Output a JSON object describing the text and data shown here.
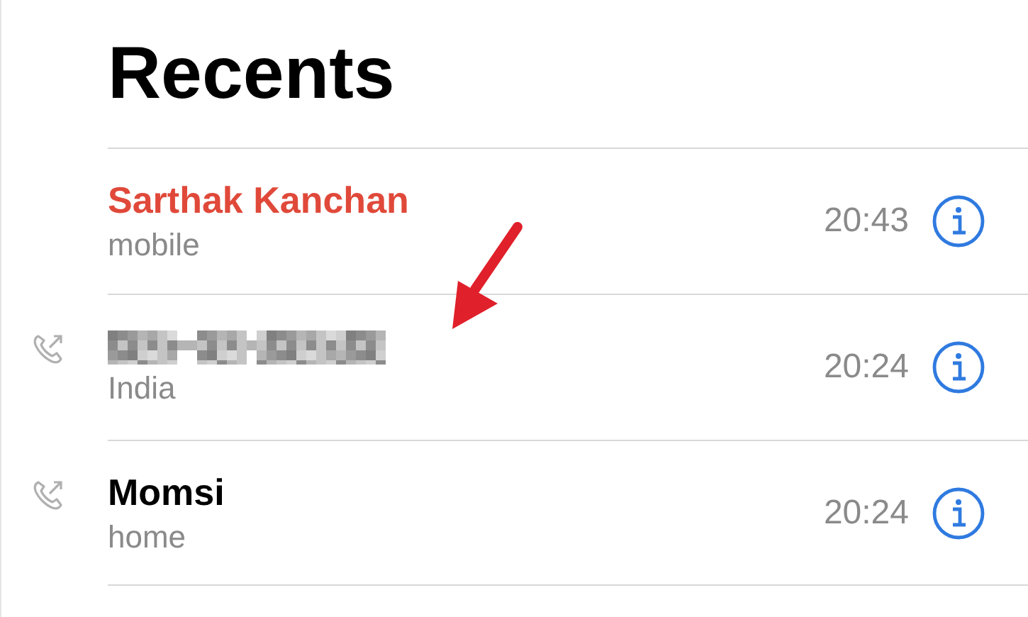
{
  "title": "Recents",
  "calls": [
    {
      "name": "Sarthak Kanchan",
      "redacted": false,
      "missed": true,
      "outgoing": false,
      "subtitle": "mobile",
      "time": "20:43"
    },
    {
      "redacted": true,
      "missed": false,
      "outgoing": true,
      "subtitle": "India",
      "time": "20:24"
    },
    {
      "name": "Momsi",
      "redacted": false,
      "missed": false,
      "outgoing": true,
      "subtitle": "home",
      "time": "20:24"
    }
  ]
}
